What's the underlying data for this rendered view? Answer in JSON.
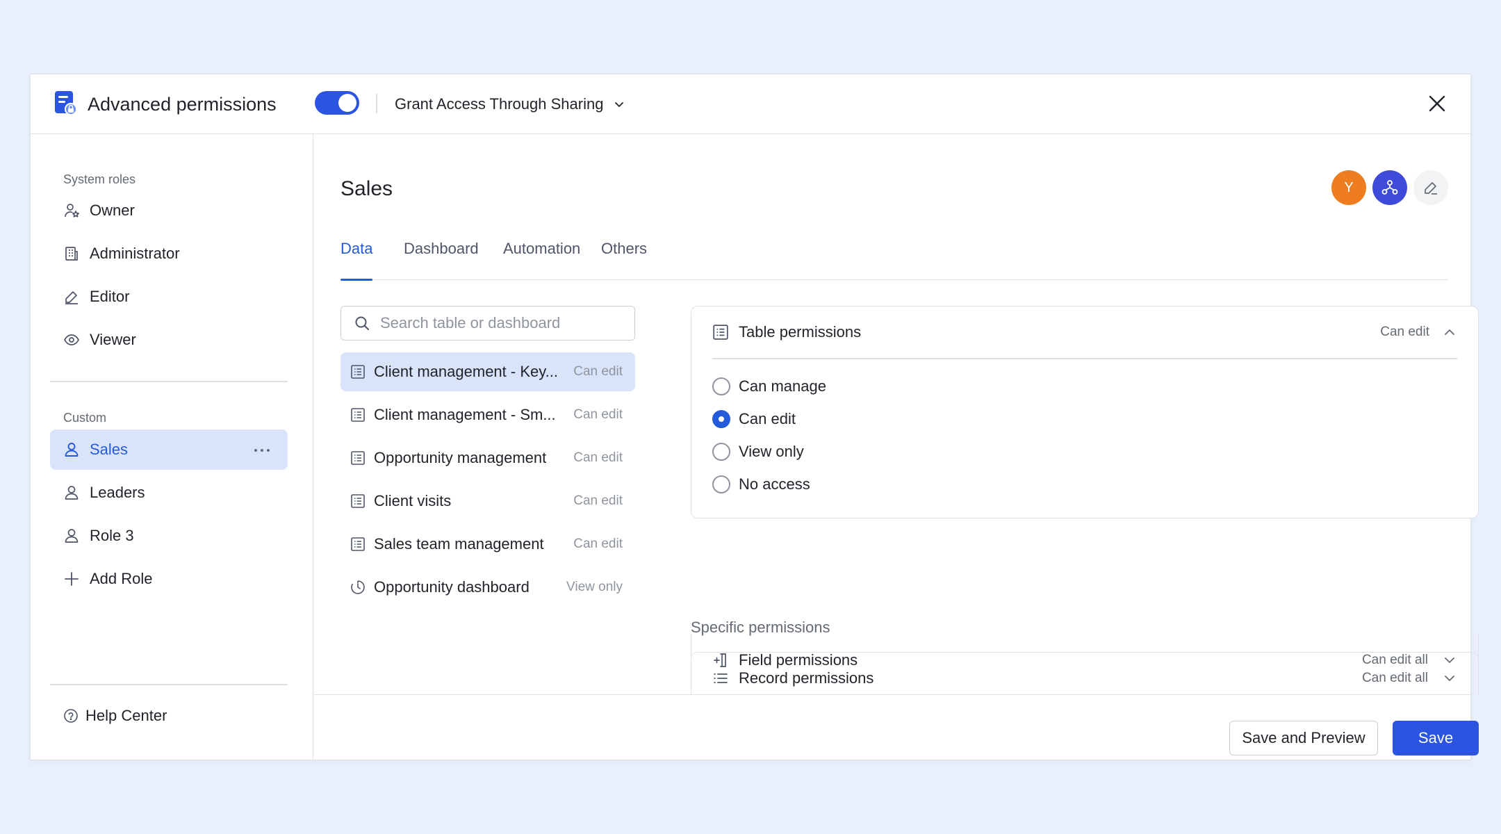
{
  "header": {
    "title": "Advanced permissions",
    "toggle_on": true,
    "sharing_label": "Grant Access Through Sharing",
    "accent_color": "#2b54e0"
  },
  "sidebar": {
    "system_roles_label": "System roles",
    "system_roles": [
      {
        "label": "Owner",
        "icon": "owner-icon"
      },
      {
        "label": "Administrator",
        "icon": "building-icon"
      },
      {
        "label": "Editor",
        "icon": "pencil-icon"
      },
      {
        "label": "Viewer",
        "icon": "eye-icon"
      }
    ],
    "custom_label": "Custom",
    "custom_roles": [
      {
        "label": "Sales",
        "icon": "user-icon",
        "active": true
      },
      {
        "label": "Leaders",
        "icon": "user-icon"
      },
      {
        "label": "Role 3",
        "icon": "user-icon"
      }
    ],
    "add_role_label": "Add Role",
    "help_label": "Help Center"
  },
  "main": {
    "title": "Sales",
    "avatar_initial": "Y",
    "tabs": [
      {
        "label": "Data",
        "active": true
      },
      {
        "label": "Dashboard"
      },
      {
        "label": "Automation"
      },
      {
        "label": "Others"
      }
    ],
    "search_placeholder": "Search table or dashboard",
    "tables": [
      {
        "name": "Client management - Key...",
        "perm": "Can edit",
        "icon": "table-icon",
        "active": true
      },
      {
        "name": "Client management - Sm...",
        "perm": "Can edit",
        "icon": "table-icon"
      },
      {
        "name": "Opportunity management",
        "perm": "Can edit",
        "icon": "table-icon"
      },
      {
        "name": "Client visits",
        "perm": "Can edit",
        "icon": "table-icon"
      },
      {
        "name": "Sales team management",
        "perm": "Can edit",
        "icon": "table-icon"
      },
      {
        "name": "Opportunity dashboard",
        "perm": "View only",
        "icon": "dashboard-icon"
      }
    ],
    "table_permissions": {
      "label": "Table permissions",
      "value": "Can edit",
      "options": [
        {
          "label": "Can manage",
          "checked": false
        },
        {
          "label": "Can edit",
          "checked": true
        },
        {
          "label": "View only",
          "checked": false
        },
        {
          "label": "No access",
          "checked": false
        }
      ]
    },
    "specific_label": "Specific permissions",
    "specific": [
      {
        "label": "Record permissions",
        "value": "Can edit all",
        "icon": "list-icon"
      },
      {
        "label": "Field permissions",
        "value": "Can edit all",
        "icon": "field-icon"
      }
    ]
  },
  "footer": {
    "save_preview_label": "Save and Preview",
    "save_label": "Save"
  }
}
